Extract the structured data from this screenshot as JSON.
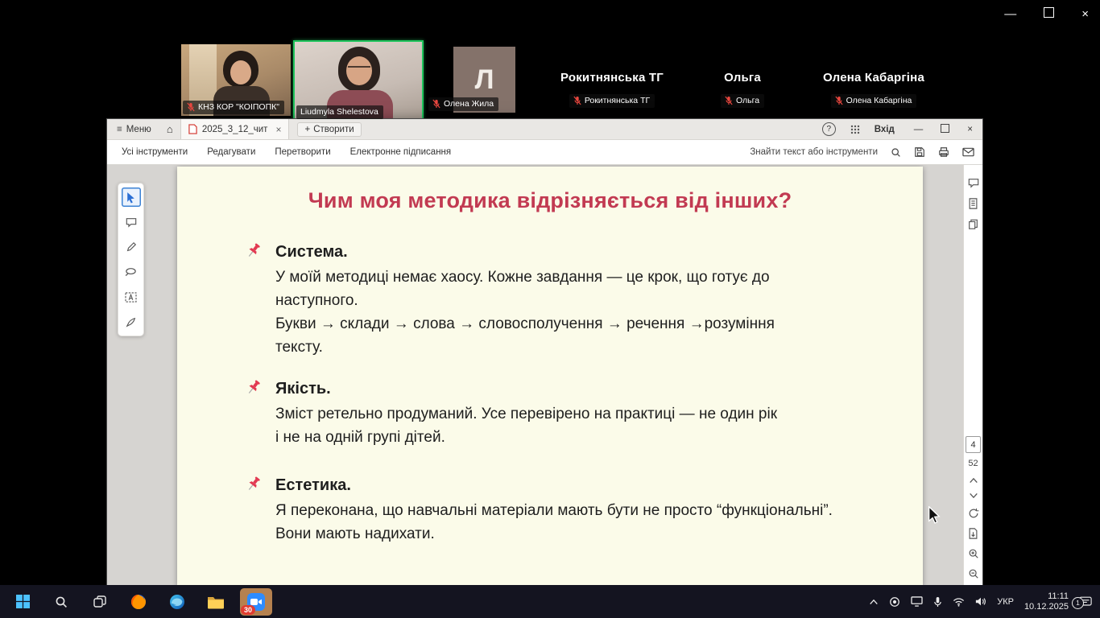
{
  "icons": {
    "menu": "≡",
    "home": "⌂",
    "tab_close": "×",
    "create_plus": "+",
    "help": "?",
    "win_min": "—",
    "win_close": "×",
    "os_min": "—",
    "os_close": "×"
  },
  "zoom": {
    "videos": [
      {
        "name": "КНЗ КОР \"КОІПОПК\""
      },
      {
        "name": "Liudmyla Shelestova"
      },
      {
        "name": "Олена Жила",
        "avatar_letter": "Л"
      }
    ],
    "audio": [
      {
        "name": "Рокитнянська ТГ"
      },
      {
        "name": "Ольга"
      },
      {
        "name": "Олена Кабаргіна"
      }
    ]
  },
  "acrobat": {
    "titlebar": {
      "menu": "Меню",
      "tab": "2025_3_12_чит",
      "create": "Створити",
      "signin": "Вхід"
    },
    "menubar": {
      "all_tools": "Усі інструменти",
      "edit": "Редагувати",
      "convert": "Перетворити",
      "esign": "Електронне підписання",
      "search": "Знайти текст або інструменти"
    },
    "pager": {
      "current": "4",
      "total": "52"
    }
  },
  "slide": {
    "title": "Чим моя методика відрізняється від інших?",
    "sections": [
      {
        "heading": "Система.",
        "body": "У моїй методиці немає хаосу.  Кожне завдання — це крок, що готує до\nнаступного.\nБукви → склади → слова → словосполучення → речення →розуміння\nтексту."
      },
      {
        "heading": "Якість.",
        "body": "Зміст ретельно продуманий. Усе перевірено на практиці — не один рік\nі не на одній групі дітей."
      },
      {
        "heading": "Естетика.",
        "body": "Я переконана, що навчальні матеріали мають бути не просто “функціональні”.\nВони мають надихати."
      }
    ]
  },
  "taskbar": {
    "zoom_badge": "30",
    "tray": {
      "language": "УКР",
      "time": "11:11",
      "date": "10.12.2025",
      "notifications": "1"
    }
  }
}
